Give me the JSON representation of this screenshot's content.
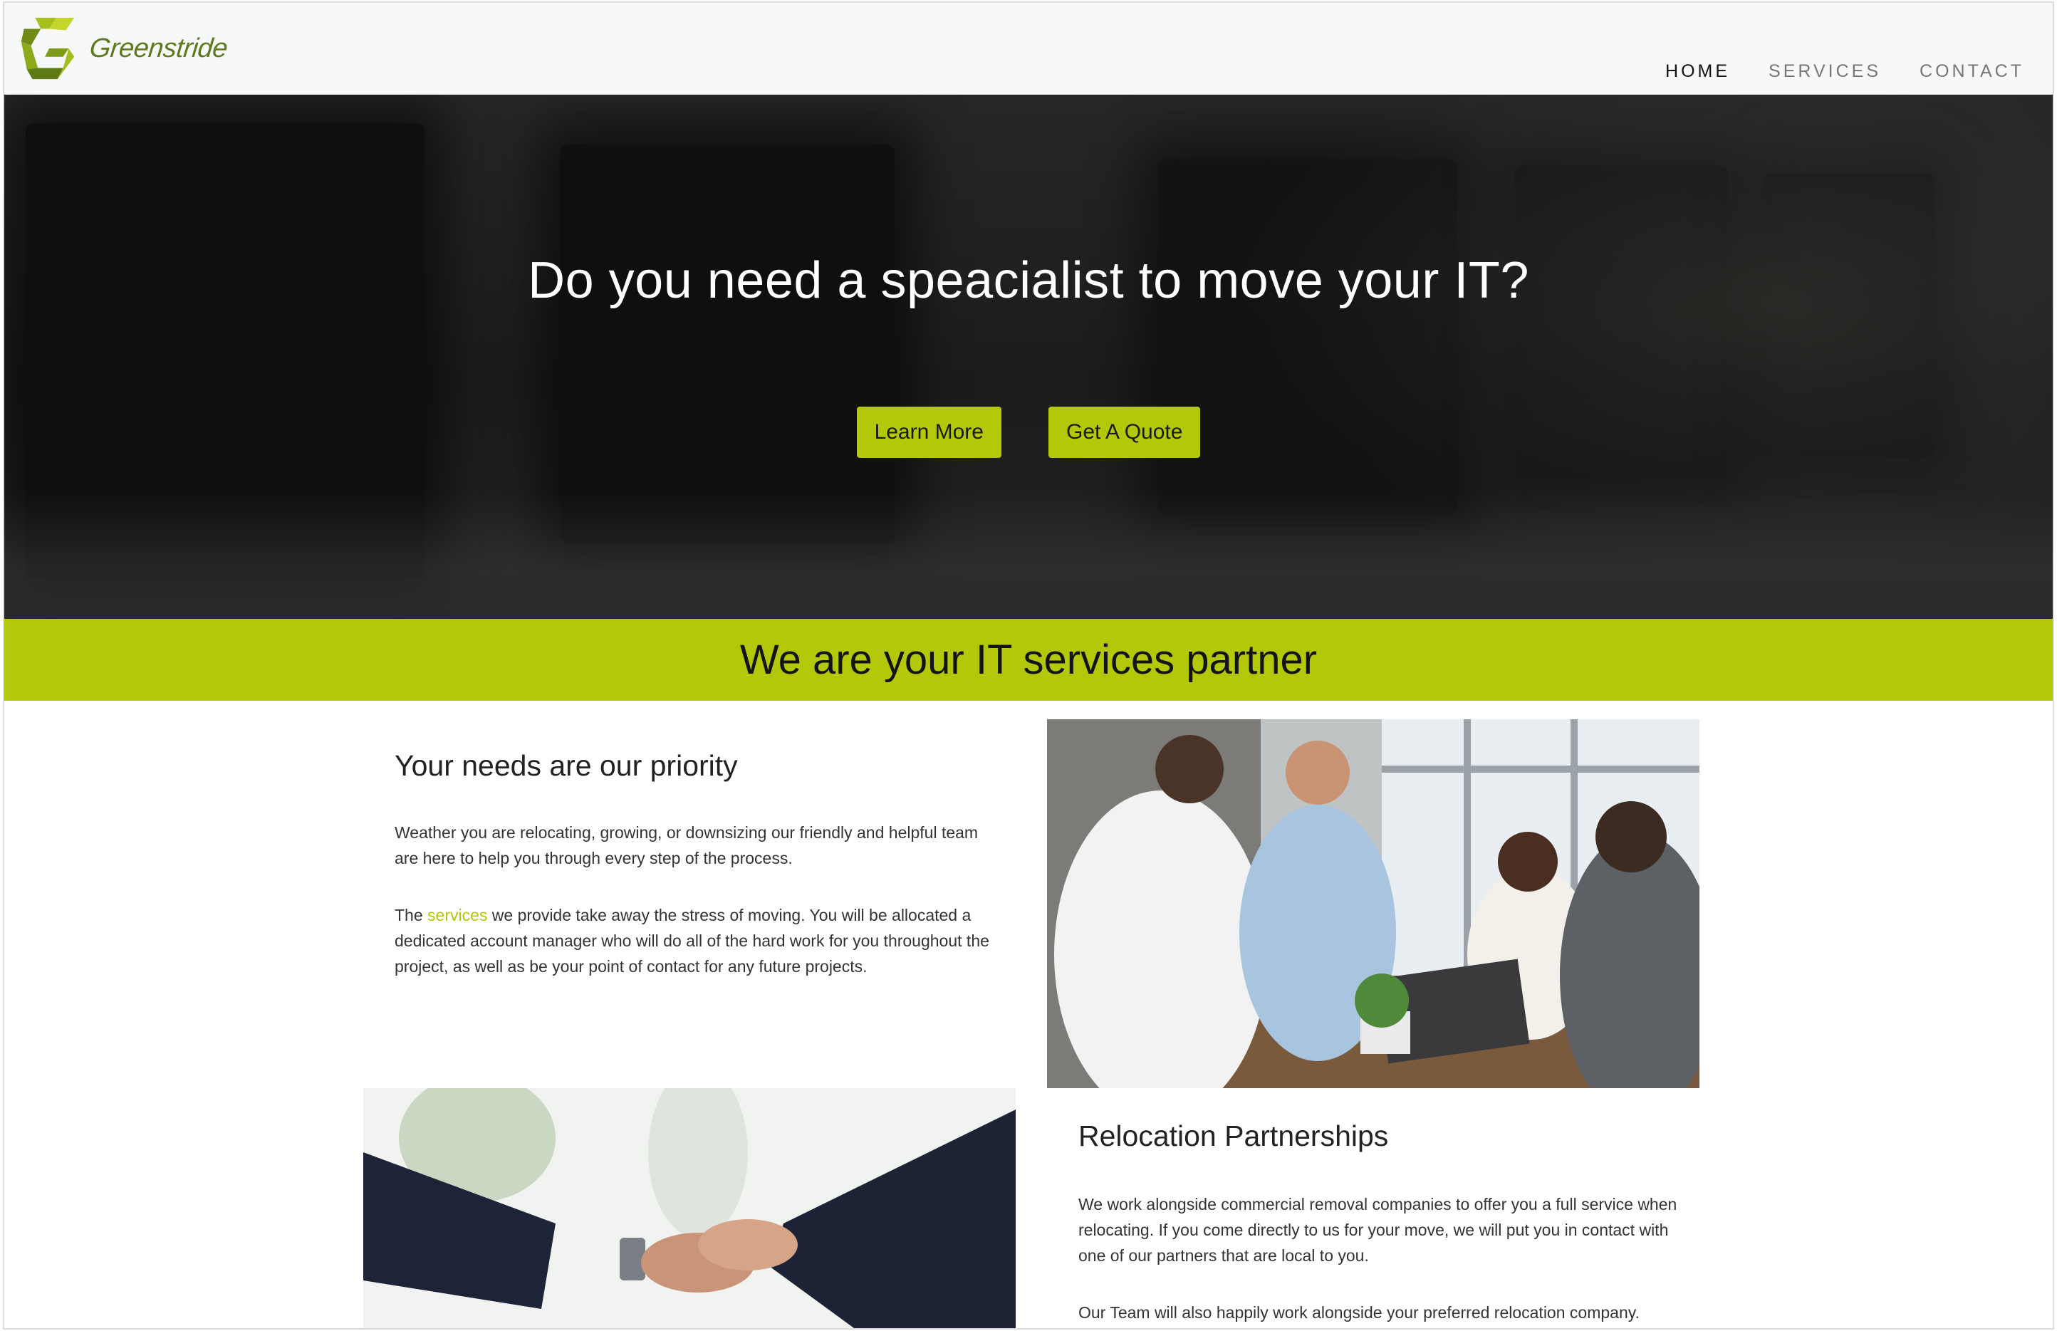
{
  "brand": {
    "name": "Greenstride",
    "logo_color": "#8aa51a"
  },
  "nav": {
    "items": [
      {
        "label": "HOME",
        "active": true
      },
      {
        "label": "SERVICES",
        "active": false
      },
      {
        "label": "CONTACT",
        "active": false
      }
    ]
  },
  "hero": {
    "heading": "Do you need a speacialist to move your IT?",
    "buttons": {
      "learn_more": "Learn More",
      "get_quote": "Get A Quote"
    }
  },
  "band": {
    "heading": "We are your IT services partner"
  },
  "priority": {
    "heading": "Your needs are our priority",
    "p1": "Weather you are relocating, growing, or downsizing our friendly and helpful team are here to help you through every step of the process.",
    "p2_before": "The ",
    "p2_link": "services",
    "p2_after": " we provide take away the stress of moving. You will be allocated a dedicated account manager who will do all of the hard work for you throughout the project, as well as be your point of contact for any future projects."
  },
  "relocation": {
    "heading": "Relocation Partnerships",
    "p1": "We work alongside commercial removal companies to offer you a full service when relocating. If you come directly to us for your move, we will put you in contact with one of our partners that are local to you.",
    "p2": "Our Team will also happily work alongside your preferred relocation company."
  },
  "colors": {
    "accent": "#b4c80a",
    "hero_bg": "#1e1f20",
    "link": "#b4c80a"
  }
}
